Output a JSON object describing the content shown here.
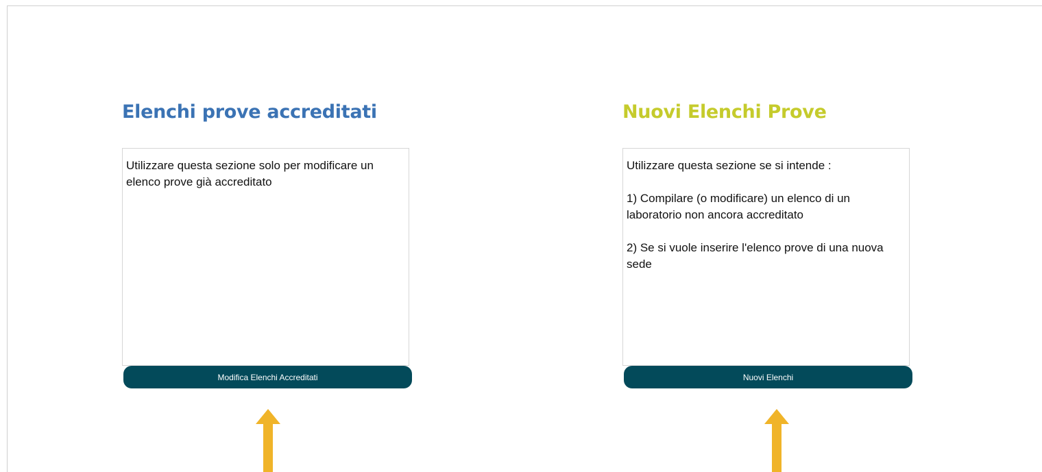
{
  "sections": {
    "accredited": {
      "title": "Elenchi prove accreditati",
      "description": "Utilizzare questa sezione solo per modificare un elenco prove già accreditato",
      "button_label": "Modifica Elenchi Accreditati"
    },
    "new": {
      "title": "Nuovi Elenchi Prove",
      "description": "Utilizzare questa sezione se si intende :\n\n 1) Compilare (o modificare) un elenco di un laboratorio non ancora accreditato\n\n 2) Se si vuole inserire l'elenco prove di una nuova sede",
      "button_label": "Nuovi Elenchi"
    }
  },
  "annotations": {
    "arrow_color": "#f0b429",
    "arrow_icon": "arrow-up-icon"
  },
  "colors": {
    "accredited_title": "#3b73b4",
    "new_title": "#c5cb2c",
    "button_background": "#034a5a"
  }
}
